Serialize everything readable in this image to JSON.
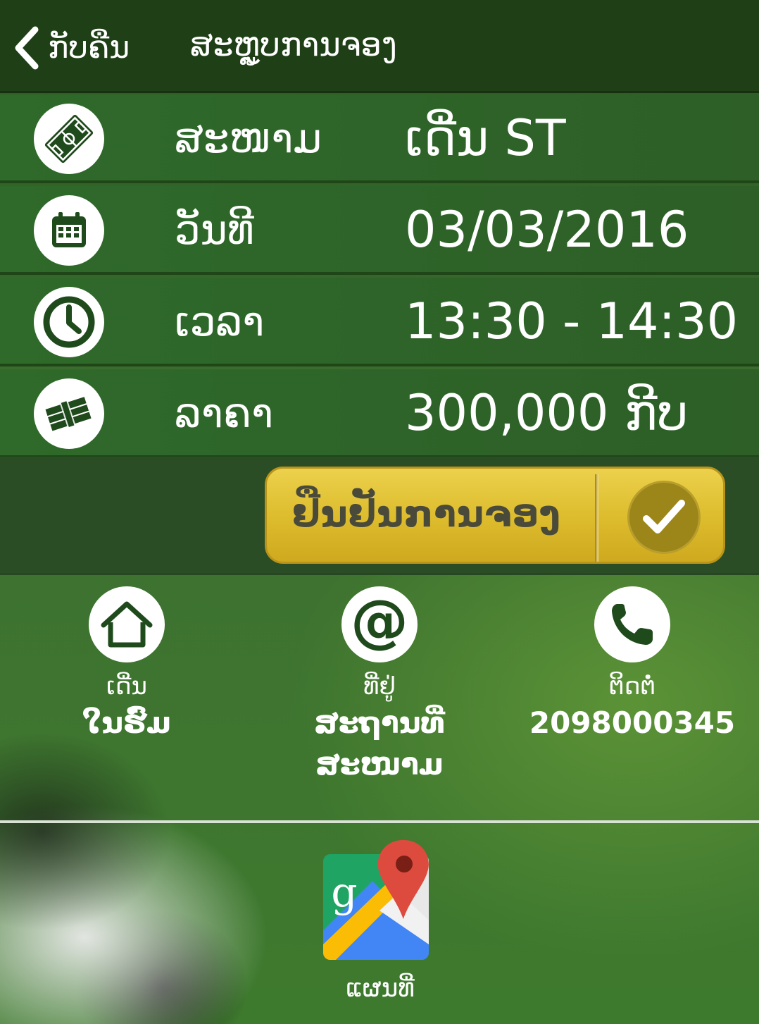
{
  "header": {
    "back_label": "ກັບຄືນ",
    "title": "ສະຫຼູບການຈອງ"
  },
  "details": [
    {
      "icon": "football-field-icon",
      "label": "ສະໜາມ",
      "value": "ເດີ່ນ ST"
    },
    {
      "icon": "calendar-icon",
      "label": "ວັນທີ",
      "value": "03/03/2016"
    },
    {
      "icon": "clock-icon",
      "label": "ເວລາ",
      "value": "13:30 - 14:30"
    },
    {
      "icon": "money-icon",
      "label": "ລາຄາ",
      "value": "300,000 ກີບ"
    }
  ],
  "confirm": {
    "label": "ຢືນຢັນການຈອງ",
    "icon": "checkmark-icon"
  },
  "info": {
    "field": {
      "icon": "home-icon",
      "caption": "ເດີ່ນ",
      "value": "ໃນຮົ່ມ"
    },
    "address": {
      "icon": "at-sign-icon",
      "caption": "ທີ່ຢູ່",
      "value": "ສະຖານທີ່ສະໜາມ"
    },
    "contact": {
      "icon": "phone-icon",
      "caption": "ຕິດຕໍ່",
      "value": "2098000345"
    }
  },
  "map": {
    "icon": "google-maps-icon",
    "label": "ແຜນທີ່"
  },
  "colors": {
    "header_bg": "#1f3f16",
    "row_bg": "#2f6a2a",
    "confirm_gold": "#dcbb2c",
    "confirm_text": "#4a4a3a",
    "icon_green": "#1f4a1c"
  }
}
